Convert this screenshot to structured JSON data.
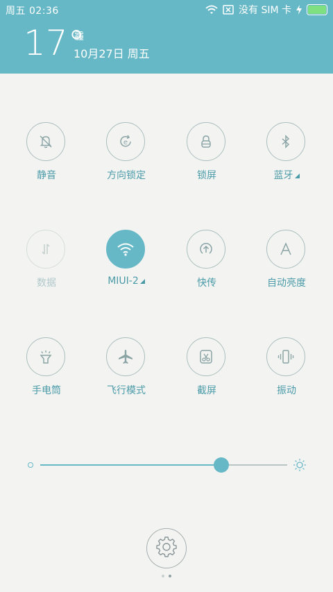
{
  "status_bar": {
    "time": "周五  02:36",
    "no_sim": "没有 SIM 卡"
  },
  "header": {
    "temperature": "17°",
    "weather": "霾",
    "date": "10月27日 周五"
  },
  "toggles": [
    {
      "label": "静音",
      "icon": "mute-bell-icon",
      "state": "off"
    },
    {
      "label": "方向锁定",
      "icon": "rotation-lock-icon",
      "state": "off"
    },
    {
      "label": "锁屏",
      "icon": "lock-icon",
      "state": "off"
    },
    {
      "label": "蓝牙",
      "icon": "bluetooth-icon",
      "state": "off"
    },
    {
      "label": "数据",
      "icon": "mobile-data-icon",
      "state": "disabled"
    },
    {
      "label": "MIUI-2",
      "icon": "wifi-icon",
      "state": "on"
    },
    {
      "label": "快传",
      "icon": "quick-transfer-icon",
      "state": "off"
    },
    {
      "label": "自动亮度",
      "icon": "auto-brightness-icon",
      "state": "off"
    },
    {
      "label": "手电筒",
      "icon": "flashlight-icon",
      "state": "off"
    },
    {
      "label": "飞行模式",
      "icon": "airplane-icon",
      "state": "off"
    },
    {
      "label": "截屏",
      "icon": "screenshot-icon",
      "state": "off"
    },
    {
      "label": "振动",
      "icon": "vibrate-icon",
      "state": "off"
    }
  ],
  "brightness": {
    "level": 0.73
  },
  "colors": {
    "accent": "#67b8c6",
    "label": "#4a9aa8",
    "background": "#f3f4f2"
  }
}
